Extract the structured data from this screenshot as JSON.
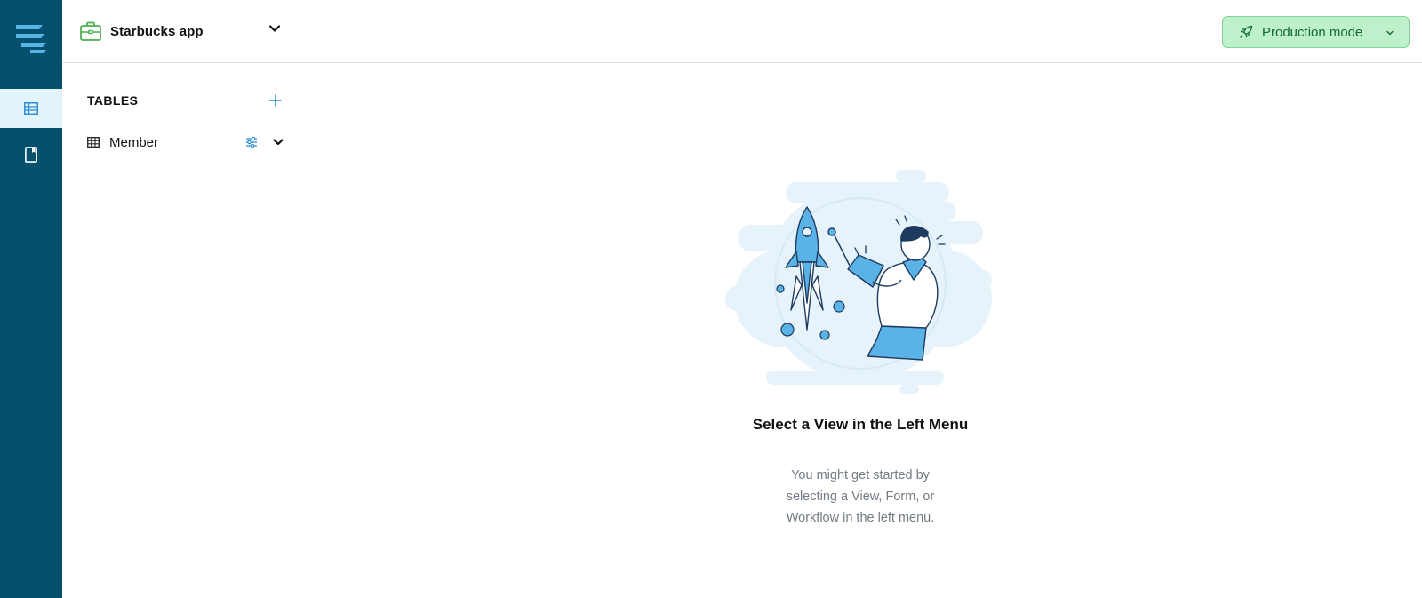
{
  "app": {
    "name": "Starbucks app"
  },
  "sidebar": {
    "section_title": "TABLES",
    "tables": [
      {
        "label": "Member"
      }
    ]
  },
  "topbar": {
    "mode_label": "Production mode"
  },
  "empty_state": {
    "title": "Select a View in the Left Menu",
    "description": "You might get started by selecting a View, Form, or Workflow in the left menu."
  },
  "icons": {
    "logo": "stacked-lines-logo-icon",
    "rail_tables": "table-grid-icon",
    "rail_docs": "document-icon",
    "app": "briefcase-icon",
    "add": "plus-icon",
    "table": "table-grid-icon",
    "settings": "sliders-icon",
    "expand": "chevron-down-icon",
    "mode": "rocket-icon"
  },
  "colors": {
    "rail_background": "#05506d",
    "rail_active": "#e3f3fc",
    "accent_blue": "#2f8fd6",
    "production_bg": "#bff0cc",
    "production_border": "#7fd59b",
    "production_text": "#0f6b2e",
    "app_icon_green": "#4caf50"
  }
}
